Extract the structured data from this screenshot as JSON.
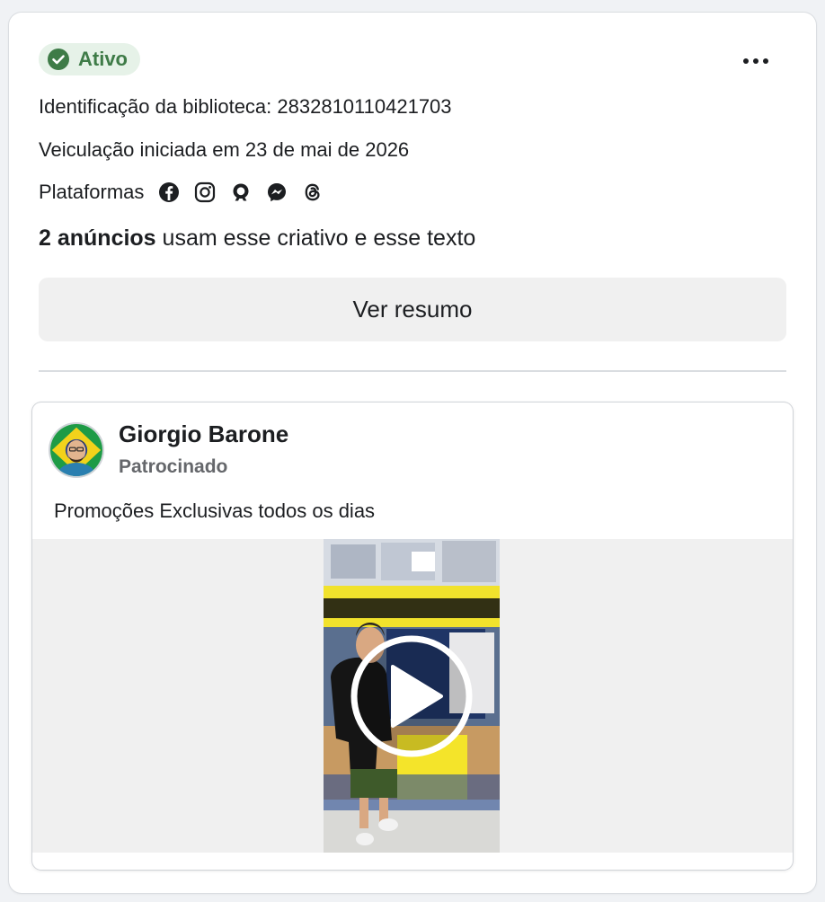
{
  "status": {
    "label": "Ativo",
    "color": "#3e7b47",
    "background": "#e6f2e8"
  },
  "menu": {
    "icon": "more-horizontal-icon"
  },
  "library_id": {
    "text": "Identificação da biblioteca: 2832810110421703"
  },
  "delivery": {
    "text": "Veiculação iniciada em 23 de mai de 2026"
  },
  "platforms": {
    "label": "Plataformas",
    "icons": [
      "facebook-icon",
      "instagram-icon",
      "audience-network-icon",
      "messenger-icon",
      "threads-icon"
    ]
  },
  "ads_count": {
    "bold": "2 anúncios",
    "rest": " usam esse criativo e esse texto"
  },
  "summary_button": {
    "label": "Ver resumo"
  },
  "ad": {
    "advertiser": "Giorgio Barone",
    "sponsored": "Patrocinado",
    "body": "Promoções Exclusivas todos os dias",
    "media": {
      "type": "video",
      "icon": "play-icon"
    }
  }
}
